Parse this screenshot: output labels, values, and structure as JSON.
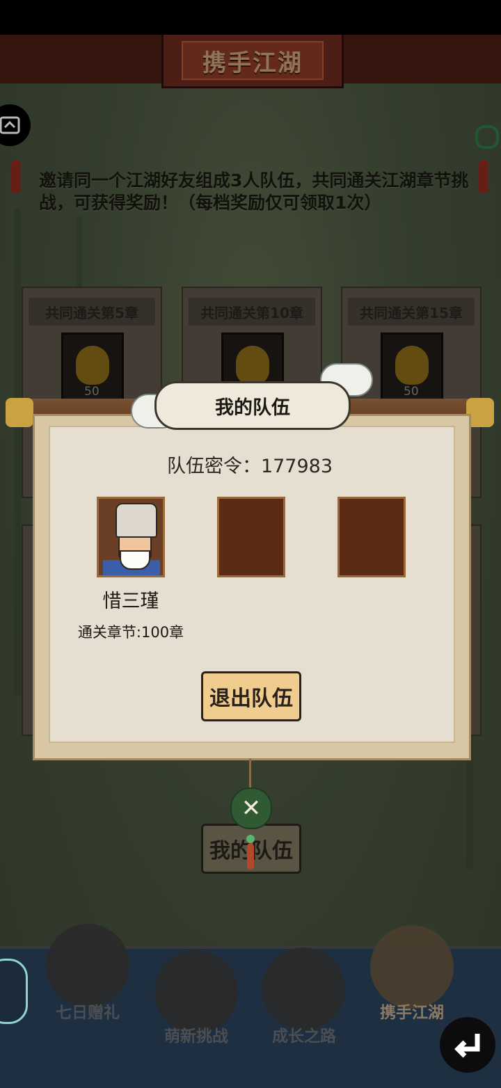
{
  "header": {
    "title": "携手江湖"
  },
  "intro": {
    "text": "邀请同一个江湖好友组成3人队伍，共同通关江湖章节挑战，可获得奖励！（每档奖励仅可领取1次）"
  },
  "rewards": [
    {
      "label": "共同通关第5章",
      "qty": "50"
    },
    {
      "label": "共同通关第10章",
      "qty": ""
    },
    {
      "label": "共同通关第15章",
      "qty": "50"
    }
  ],
  "team_dialog": {
    "title": "我的队伍",
    "code_line": "队伍密令：177983",
    "member": {
      "name": "惜三瑾",
      "chapter": "通关章节:100章"
    },
    "leave_label": "退出队伍"
  },
  "my_team_button": "我的队伍",
  "bottom_nav": [
    {
      "label": "七日赠礼"
    },
    {
      "label": "萌新挑战"
    },
    {
      "label": "成长之路"
    },
    {
      "label": "携手江湖"
    }
  ],
  "icons": {
    "close": "close-icon",
    "puzzle": "puzzle-icon",
    "back": "back-arrow-icon"
  }
}
